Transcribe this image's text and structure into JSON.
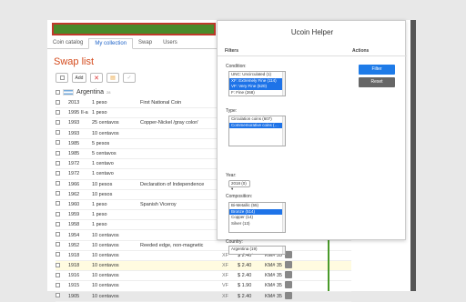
{
  "tabs": [
    "Coin catalog",
    "My collection",
    "Swap",
    "Users"
  ],
  "swap_title": "Swap list",
  "toolbar": {
    "add": "Add"
  },
  "country": {
    "name": "Argentina",
    "count": "28"
  },
  "rows": [
    {
      "year": "2013",
      "value": "1 peso",
      "desc": "First National Coin",
      "cond": "",
      "price": "",
      "km": ""
    },
    {
      "year": "1995 II-a",
      "value": "1 peso",
      "desc": "",
      "cond": "",
      "price": "",
      "km": ""
    },
    {
      "year": "1993",
      "value": "25 centavos",
      "desc": "Copper-Nickel /gray color/",
      "cond": "",
      "price": "",
      "km": ""
    },
    {
      "year": "1993",
      "value": "10 centavos",
      "desc": "",
      "cond": "",
      "price": "",
      "km": ""
    },
    {
      "year": "1985",
      "value": "5 pesos",
      "desc": "",
      "cond": "",
      "price": "",
      "km": ""
    },
    {
      "year": "1985",
      "value": "5 centavos",
      "desc": "",
      "cond": "",
      "price": "",
      "km": ""
    },
    {
      "year": "1972",
      "value": "1 centavo",
      "desc": "",
      "cond": "",
      "price": "",
      "km": ""
    },
    {
      "year": "1972",
      "value": "1 centavo",
      "desc": "",
      "cond": "",
      "price": "",
      "km": ""
    },
    {
      "year": "1966",
      "value": "10 pesos",
      "desc": "Declaration of Independence",
      "cond": "",
      "price": "",
      "km": ""
    },
    {
      "year": "1962",
      "value": "10 pesos",
      "desc": "",
      "cond": "",
      "price": "",
      "km": ""
    },
    {
      "year": "1960",
      "value": "1 peso",
      "desc": "Spanish Viceroy",
      "cond": "",
      "price": "",
      "km": ""
    },
    {
      "year": "1959",
      "value": "1 peso",
      "desc": "",
      "cond": "",
      "price": "",
      "km": ""
    },
    {
      "year": "1958",
      "value": "1 peso",
      "desc": "",
      "cond": "",
      "price": "",
      "km": ""
    },
    {
      "year": "1954",
      "value": "10 centavos",
      "desc": "",
      "cond": "",
      "price": "",
      "km": ""
    },
    {
      "year": "1952",
      "value": "10 centavos",
      "desc": "Reeded edge, non-magnetic",
      "cond": "",
      "price": "",
      "km": ""
    },
    {
      "year": "1918",
      "value": "10 centavos",
      "desc": "",
      "cond": "XF",
      "price": "$ 2.40",
      "km": "KM# 35"
    },
    {
      "year": "1918",
      "value": "10 centavos",
      "desc": "",
      "cond": "XF",
      "price": "$ 2.40",
      "km": "KM# 35"
    },
    {
      "year": "1916",
      "value": "10 centavos",
      "desc": "",
      "cond": "XF",
      "price": "$ 2.40",
      "km": "KM# 35"
    },
    {
      "year": "1915",
      "value": "10 centavos",
      "desc": "",
      "cond": "VF",
      "price": "$ 1.90",
      "km": "KM# 35"
    },
    {
      "year": "1905",
      "value": "10 centavos",
      "desc": "",
      "cond": "XF",
      "price": "$ 2.40",
      "km": "KM# 35"
    }
  ],
  "popup": {
    "title": "Ucoin Helper",
    "filters_label": "Filters",
    "actions_label": "Actions",
    "condition_label": "Condition:",
    "condition_options": [
      {
        "text": "UNC: Uncirculated (1)",
        "selected": false
      },
      {
        "text": "XF: Extremely Fine (114)",
        "selected": true
      },
      {
        "text": "VF: Very Fine (520)",
        "selected": true
      },
      {
        "text": "F: Fine (268)",
        "selected": false
      }
    ],
    "type_label": "Type:",
    "type_options": [
      {
        "text": "Circulation coins (607)",
        "selected": false
      },
      {
        "text": "Commemorative coins (…",
        "selected": true
      }
    ],
    "year_label": "Year:",
    "year_value": "2018 (0)",
    "composition_label": "Composition:",
    "composition_options": [
      {
        "text": "Bi-Metallic (55)",
        "selected": false
      },
      {
        "text": "Bronze (514)",
        "selected": true
      },
      {
        "text": "Copper (14)",
        "selected": false
      },
      {
        "text": "Silver (13)",
        "selected": false
      }
    ],
    "country_label": "Country:",
    "country_options": [
      {
        "text": "Argentina (19)",
        "selected": false
      },
      {
        "text": "Australia (1)",
        "selected": false
      }
    ],
    "filter_button": "Filter",
    "reset_button": "Reset"
  },
  "colors": {
    "accent": "#1e73e8",
    "title": "#d44a1c",
    "highlight_bar": "#4a8a2a"
  }
}
